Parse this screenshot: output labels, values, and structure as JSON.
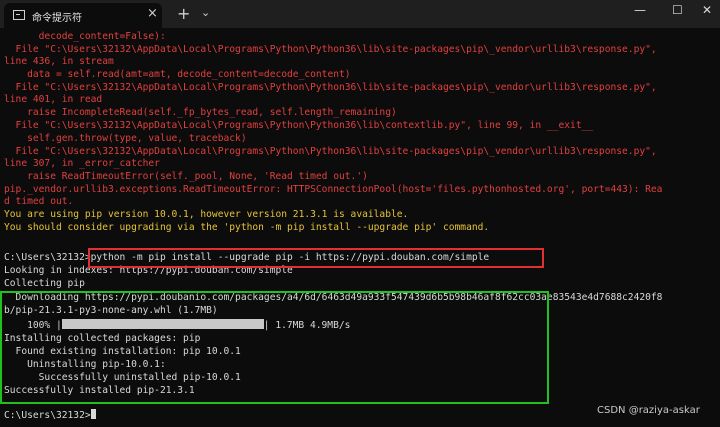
{
  "window": {
    "tab_title": "命令提示符",
    "close_tab_glyph": "×",
    "new_tab_glyph": "+",
    "dropdown_glyph": "⌄",
    "minimize_glyph": "—",
    "maximize_glyph": "☐",
    "close_glyph": "✕"
  },
  "terminal": {
    "error_lines": [
      "      decode_content=False):",
      "  File \"C:\\Users\\32132\\AppData\\Local\\Programs\\Python\\Python36\\lib\\site-packages\\pip\\_vendor\\urllib3\\response.py\",",
      "line 436, in stream",
      "    data = self.read(amt=amt, decode_content=decode_content)",
      "  File \"C:\\Users\\32132\\AppData\\Local\\Programs\\Python\\Python36\\lib\\site-packages\\pip\\_vendor\\urllib3\\response.py\",",
      "line 401, in read",
      "    raise IncompleteRead(self._fp_bytes_read, self.length_remaining)",
      "  File \"C:\\Users\\32132\\AppData\\Local\\Programs\\Python\\Python36\\lib\\contextlib.py\", line 99, in __exit__",
      "    self.gen.throw(type, value, traceback)",
      "  File \"C:\\Users\\32132\\AppData\\Local\\Programs\\Python\\Python36\\lib\\site-packages\\pip\\_vendor\\urllib3\\response.py\",",
      "line 307, in _error_catcher",
      "    raise ReadTimeoutError(self._pool, None, 'Read timed out.')",
      "pip._vendor.urllib3.exceptions.ReadTimeoutError: HTTPSConnectionPool(host='files.pythonhosted.org', port=443): Rea",
      "d timed out."
    ],
    "warning_lines": [
      "You are using pip version 10.0.1, however version 21.3.1 is available.",
      "You should consider upgrading via the 'python -m pip install --upgrade pip' command."
    ],
    "prompt": "C:\\Users\\32132>",
    "command": "python -m pip install --upgrade pip -i https://pypi.douban.com/simple",
    "output_lines": [
      "Looking in indexes: https://pypi.douban.com/simple",
      "Collecting pip",
      "  Downloading https://pypi.doubanio.com/packages/a4/6d/6463d49a933f547439d6b5b98b46af8f62cc03ae83543e4d7688c2420f8",
      "b/pip-21.3.1-py3-none-any.whl (1.7MB)"
    ],
    "progress": {
      "label": "    100% |",
      "fraction": 1.0,
      "suffix": "| 1.7MB 4.9MB/s"
    },
    "install_lines": [
      "Installing collected packages: pip",
      "  Found existing installation: pip 10.0.1",
      "    Uninstalling pip-10.0.1:",
      "      Successfully uninstalled pip-10.0.1",
      "Successfully installed pip-21.3.1"
    ],
    "final_prompt": "C:\\Users\\32132>"
  },
  "watermark": "CSDN @raziya-askar",
  "colors": {
    "error": "#e0403f",
    "warning": "#e5c33a",
    "text": "#d9d9d9",
    "highlight_red": "#e0302f",
    "highlight_green": "#21c021",
    "background": "#0c0c0c"
  }
}
